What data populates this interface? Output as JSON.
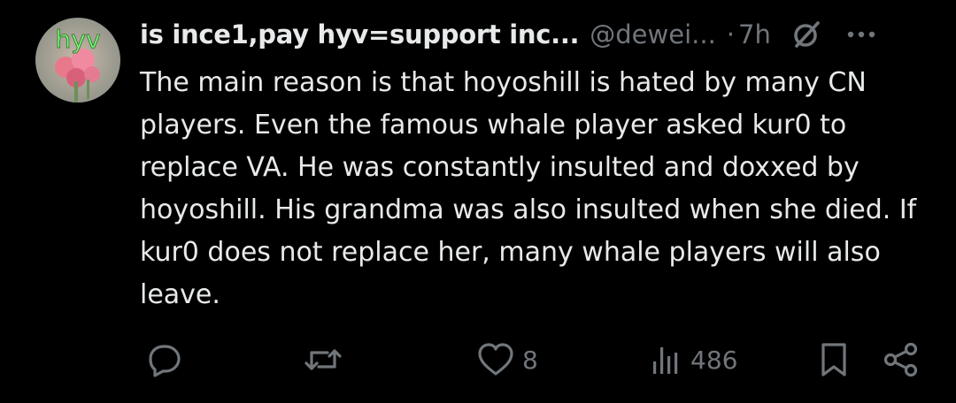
{
  "tweet": {
    "avatar_label": "hyv",
    "display_name": "is ince1,pay hyv=support inc...",
    "handle": "@dewei...",
    "separator": "·",
    "time": "7h",
    "text": "The main reason is that hoyoshill is hated by many CN players. Even the famous whale player asked kur0 to replace VA. He was constantly insulted and doxxed by hoyoshill. His grandma was also insulted when she died. If kur0 does not replace her, many whale players will also leave."
  },
  "actions": {
    "reply_icon": "reply-icon",
    "retweet_icon": "retweet-icon",
    "like_icon": "heart-icon",
    "like_count": "8",
    "views_icon": "views-icon",
    "views_count": "486",
    "bookmark_icon": "bookmark-icon",
    "share_icon": "share-icon"
  },
  "colors": {
    "background": "#000000",
    "text": "#e7e9ea",
    "muted": "#71767b",
    "avatar_text": "#7dff7a"
  }
}
